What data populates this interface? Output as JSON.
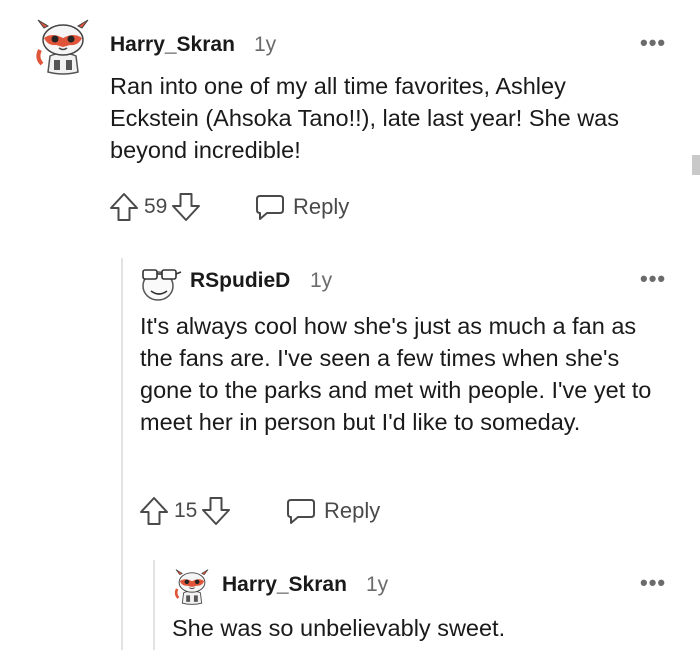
{
  "comments": [
    {
      "username": "Harry_Skran",
      "age": "1y",
      "body": "Ran into one of my all time favorites, Ashley Eckstein (Ahsoka Tano!!), late last year! She was beyond incredible!",
      "score": "59",
      "reply_label": "Reply",
      "more_label": "•••",
      "avatar_icon": "snoo-avatar-icon"
    },
    {
      "username": "RSpudieD",
      "age": "1y",
      "body": "It's always cool how she's just as much a fan as the fans are. I've seen a few times when she's gone to the parks and met with people. I've yet to meet her in person but I'd like to someday.",
      "score": "15",
      "reply_label": "Reply",
      "more_label": "•••",
      "avatar_icon": "glasses-face-avatar-icon"
    },
    {
      "username": "Harry_Skran",
      "age": "1y",
      "body": "She was so unbelievably sweet.",
      "more_label": "•••",
      "avatar_icon": "snoo-avatar-icon"
    }
  ],
  "colors": {
    "text": "#1a1a1b",
    "muted": "#6b6b6b",
    "thread_line": "#e3e3e3",
    "avatar_accent": "#e0553a"
  }
}
